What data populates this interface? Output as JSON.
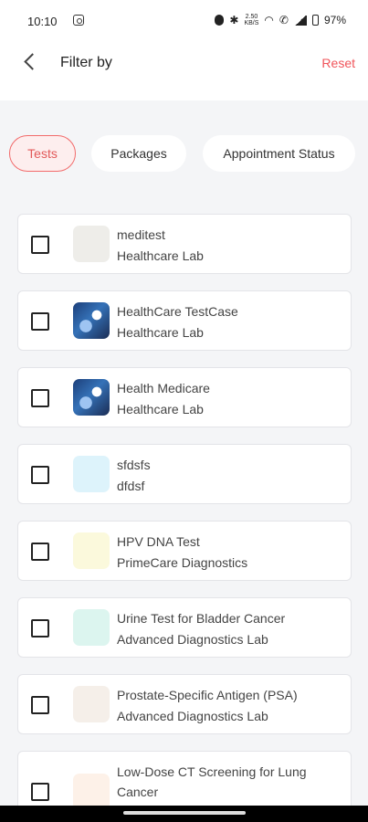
{
  "status_bar": {
    "time": "10:10",
    "network_speed_value": "2.50",
    "network_speed_unit": "KB/S",
    "battery": "97%",
    "icons": [
      "instagram-icon",
      "dnd-icon",
      "bluetooth-icon",
      "wifi-icon",
      "call-icon",
      "signal-icon",
      "battery-icon"
    ]
  },
  "header": {
    "back_icon": "chevron-left-icon",
    "title": "Filter by",
    "reset_label": "Reset"
  },
  "tabs": [
    {
      "label": "Tests",
      "active": true
    },
    {
      "label": "Packages",
      "active": false
    },
    {
      "label": "Appointment Status",
      "active": false
    }
  ],
  "items": [
    {
      "name": "meditest",
      "lab": "Healthcare Lab",
      "thumb_color": "#eeede9",
      "checked": false
    },
    {
      "name": "HealthCare TestCase",
      "lab": "Healthcare Lab",
      "thumb_color": "#2a5aa0",
      "checked": false
    },
    {
      "name": "Health Medicare",
      "lab": "Healthcare Lab",
      "thumb_color": "#2a5aa0",
      "checked": false
    },
    {
      "name": "sfdsfs",
      "lab": "dfdsf",
      "thumb_color": "#ddf3fb",
      "checked": false
    },
    {
      "name": "HPV DNA Test",
      "lab": "PrimeCare Diagnostics",
      "thumb_color": "#fbf9dc",
      "checked": false
    },
    {
      "name": "Urine Test for Bladder Cancer",
      "lab": "Advanced Diagnostics Lab",
      "thumb_color": "#dcf5ef",
      "checked": false
    },
    {
      "name": "Prostate-Specific Antigen (PSA)",
      "lab": "Advanced Diagnostics Lab",
      "thumb_color": "#f5efe9",
      "checked": false
    },
    {
      "name": "Low-Dose CT Screening for Lung Cancer",
      "lab": "",
      "thumb_color": "#fdf1e8",
      "checked": false
    }
  ],
  "colors": {
    "accent": "#f0545a",
    "chip_active_bg": "#fdeeee",
    "page_bg": "#f4f5f7"
  }
}
